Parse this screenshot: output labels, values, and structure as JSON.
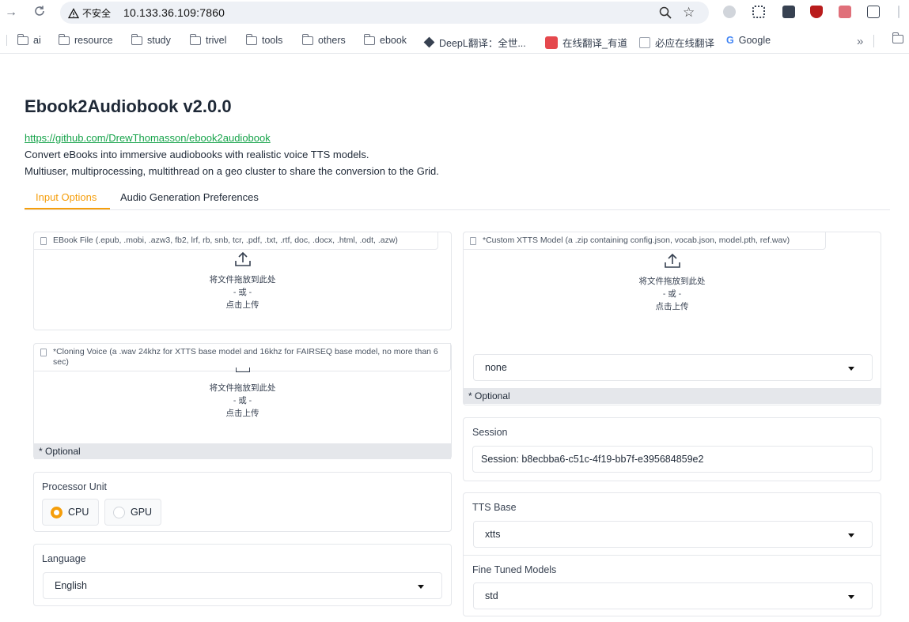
{
  "browser": {
    "security_label": "不安全",
    "url": "10.133.36.109:7860",
    "bookmarks": [
      {
        "label": "ai"
      },
      {
        "label": "resource"
      },
      {
        "label": "study"
      },
      {
        "label": "trivel"
      },
      {
        "label": "tools"
      },
      {
        "label": "others"
      },
      {
        "label": "ebook"
      },
      {
        "label": "DeepL翻译：全世..."
      },
      {
        "label": "在线翻译_有道"
      },
      {
        "label": "必应在线翻译"
      },
      {
        "label": "Google"
      }
    ],
    "overflow_label": "»"
  },
  "app": {
    "title": "Ebook2Audiobook v2.0.0",
    "repo_link": "https://github.com/DrewThomasson/ebook2audiobook",
    "description_1": "Convert eBooks into immersive audiobooks with realistic voice TTS models.",
    "description_2": "Multiuser, multiprocessing, multithread on a geo cluster to share the conversion to the Grid."
  },
  "tabs": [
    {
      "label": "Input Options",
      "active": true
    },
    {
      "label": "Audio Generation Preferences",
      "active": false
    }
  ],
  "upload": {
    "drop_text": "将文件拖放到此处",
    "or_text": "- 或 -",
    "click_text": "点击上传"
  },
  "ebook_file": {
    "label": "EBook File (.epub, .mobi, .azw3, fb2, lrf, rb, snb, tcr, .pdf, .txt, .rtf, doc, .docx, .html, .odt, .azw)"
  },
  "cloning_voice": {
    "label": "*Cloning Voice (a .wav 24khz for XTTS base model and 16khz for FAIRSEQ base model, no more than 6 sec)",
    "optional": "* Optional"
  },
  "custom_model": {
    "label": "*Custom XTTS Model (a .zip containing config.json, vocab.json, model.pth, ref.wav)",
    "select_value": "none",
    "optional": "* Optional"
  },
  "processor": {
    "label": "Processor Unit",
    "options": [
      {
        "label": "CPU",
        "selected": true
      },
      {
        "label": "GPU",
        "selected": false
      }
    ]
  },
  "language": {
    "label": "Language",
    "value": "English"
  },
  "session": {
    "label": "Session",
    "value": "Session: b8ecbba6-c51c-4f19-bb7f-e395684859e2"
  },
  "tts_base": {
    "label": "TTS Base",
    "value": "xtts"
  },
  "fine_tuned": {
    "label": "Fine Tuned Models",
    "value": "std"
  },
  "colors": {
    "accent": "#f59e0b",
    "link": "#16a34a",
    "optional_bg": "#e5e7eb"
  }
}
